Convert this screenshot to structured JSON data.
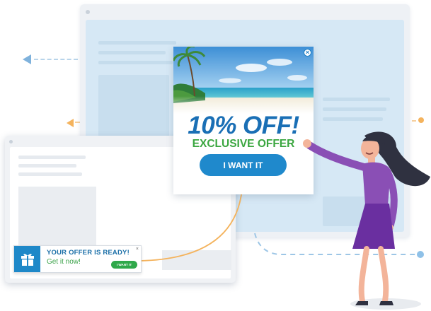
{
  "popup": {
    "headline": "10% OFF!",
    "subheadline": "EXCLUSIVE OFFER",
    "cta_label": "I WANT IT",
    "close_icon": "close-icon"
  },
  "toast": {
    "title": "YOUR OFFER IS READY!",
    "subtitle": "Get it now!",
    "cta_label": "I WANT IT",
    "close_label": "×",
    "icon": "gift-icon"
  },
  "colors": {
    "brand_blue": "#1f89cc",
    "offer_green": "#3aa63f",
    "arrow_orange": "#f4b35d",
    "panel_blue": "#d6e8f5"
  }
}
